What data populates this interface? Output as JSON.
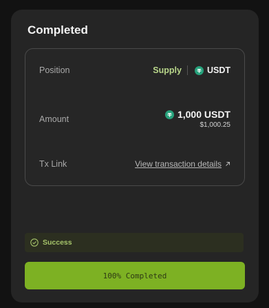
{
  "title": "Completed",
  "details": {
    "position_label": "Position",
    "position_action": "Supply",
    "position_token": "USDT",
    "amount_label": "Amount",
    "amount_value": "1,000 USDT",
    "amount_usd": "$1,000.25",
    "tx_label": "Tx Link",
    "tx_link_text": "View transaction details"
  },
  "status": {
    "text": "Success"
  },
  "progress": {
    "label": "100% Completed",
    "percent": 100
  },
  "colors": {
    "accent": "#7db123",
    "token": "#26a17b",
    "supply": "#b8d68a",
    "success": "#a6c46a"
  },
  "icons": {
    "token": "tether-icon",
    "external": "arrow-up-right-icon",
    "success": "check-circle-icon"
  }
}
